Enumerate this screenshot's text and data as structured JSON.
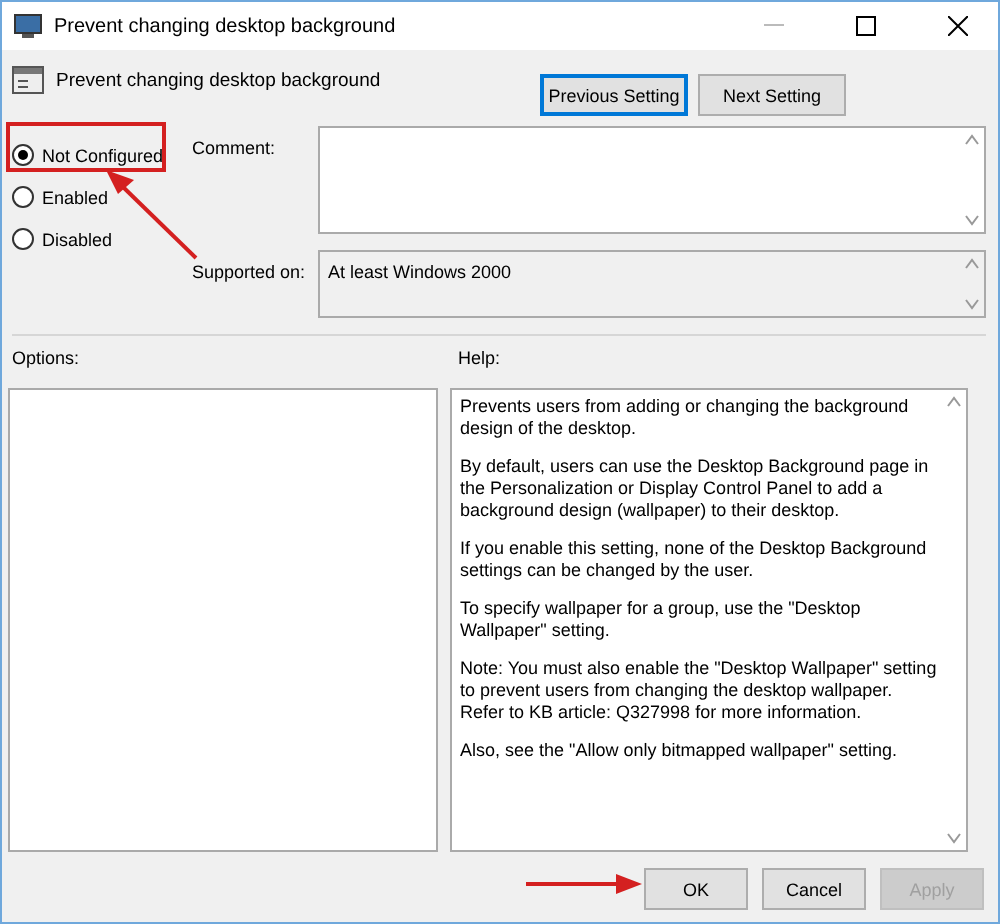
{
  "window": {
    "title": "Prevent changing desktop background"
  },
  "header": {
    "title": "Prevent changing desktop background"
  },
  "nav_buttons": [
    {
      "label": "Previous Setting",
      "focused": true
    },
    {
      "label": "Next Setting",
      "focused": false
    }
  ],
  "options": [
    {
      "label": "Not Configured",
      "selected": true
    },
    {
      "label": "Enabled",
      "selected": false
    },
    {
      "label": "Disabled",
      "selected": false
    }
  ],
  "comment": {
    "label": "Comment:"
  },
  "supported_on": {
    "label": "Supported on:",
    "value": "At least Windows 2000"
  },
  "options_panel": {
    "label": "Options:"
  },
  "help_panel": {
    "label": "Help:",
    "paragraphs": [
      "Prevents users from adding or changing the background design of the desktop.",
      "By default, users can use the Desktop Background page in the Personalization or Display Control Panel to add a background design (wallpaper) to their desktop.",
      "If you enable this setting, none of the Desktop Background settings can be changed by the user.",
      "To specify wallpaper for a group, use the \"Desktop Wallpaper\" setting.",
      "Note: You must also enable the \"Desktop Wallpaper\" setting to prevent users from changing the desktop wallpaper. Refer to KB article: Q327998 for more information.",
      "Also, see the \"Allow only bitmapped wallpaper\" setting."
    ]
  },
  "buttons": [
    {
      "label": "OK",
      "disabled": false
    },
    {
      "label": "Cancel",
      "disabled": false
    },
    {
      "label": "Apply",
      "disabled": true
    }
  ]
}
